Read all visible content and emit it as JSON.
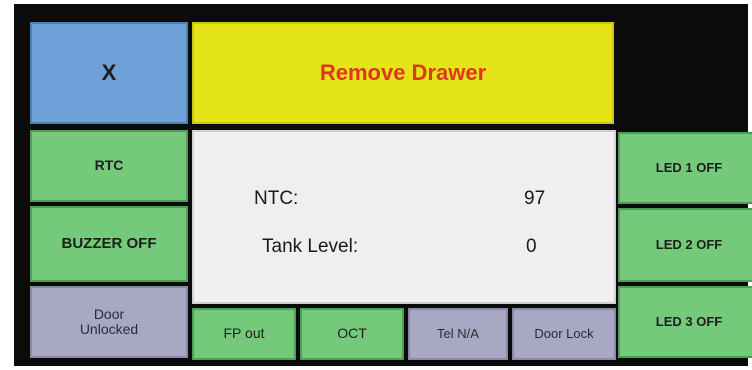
{
  "header": {
    "close_label": "X",
    "banner_text": "Remove Drawer"
  },
  "left_column": {
    "rtc_label": "RTC",
    "buzzer_label": "BUZZER OFF",
    "door_status_line1": "Door",
    "door_status_line2": "Unlocked"
  },
  "right_column": {
    "led1_label": "LED 1 OFF",
    "led2_label": "LED 2 OFF",
    "led3_label": "LED 3 OFF"
  },
  "status": {
    "ntc_label": "NTC:",
    "ntc_value": "97",
    "tank_label": "Tank Level:",
    "tank_value": "0"
  },
  "bottom_row": {
    "fp_out_label": "FP out",
    "oct_label": "OCT",
    "tel_label": "Tel N/A",
    "door_lock_label": "Door Lock"
  },
  "colors": {
    "button_green": "#74c97a",
    "button_blue": "#6fa0d8",
    "button_gray": "#a9a8c4",
    "banner_yellow": "#e4e418",
    "banner_text_red": "#e0361b",
    "panel_background": "#f0eeee",
    "screen_background": "#0b0b0b"
  }
}
